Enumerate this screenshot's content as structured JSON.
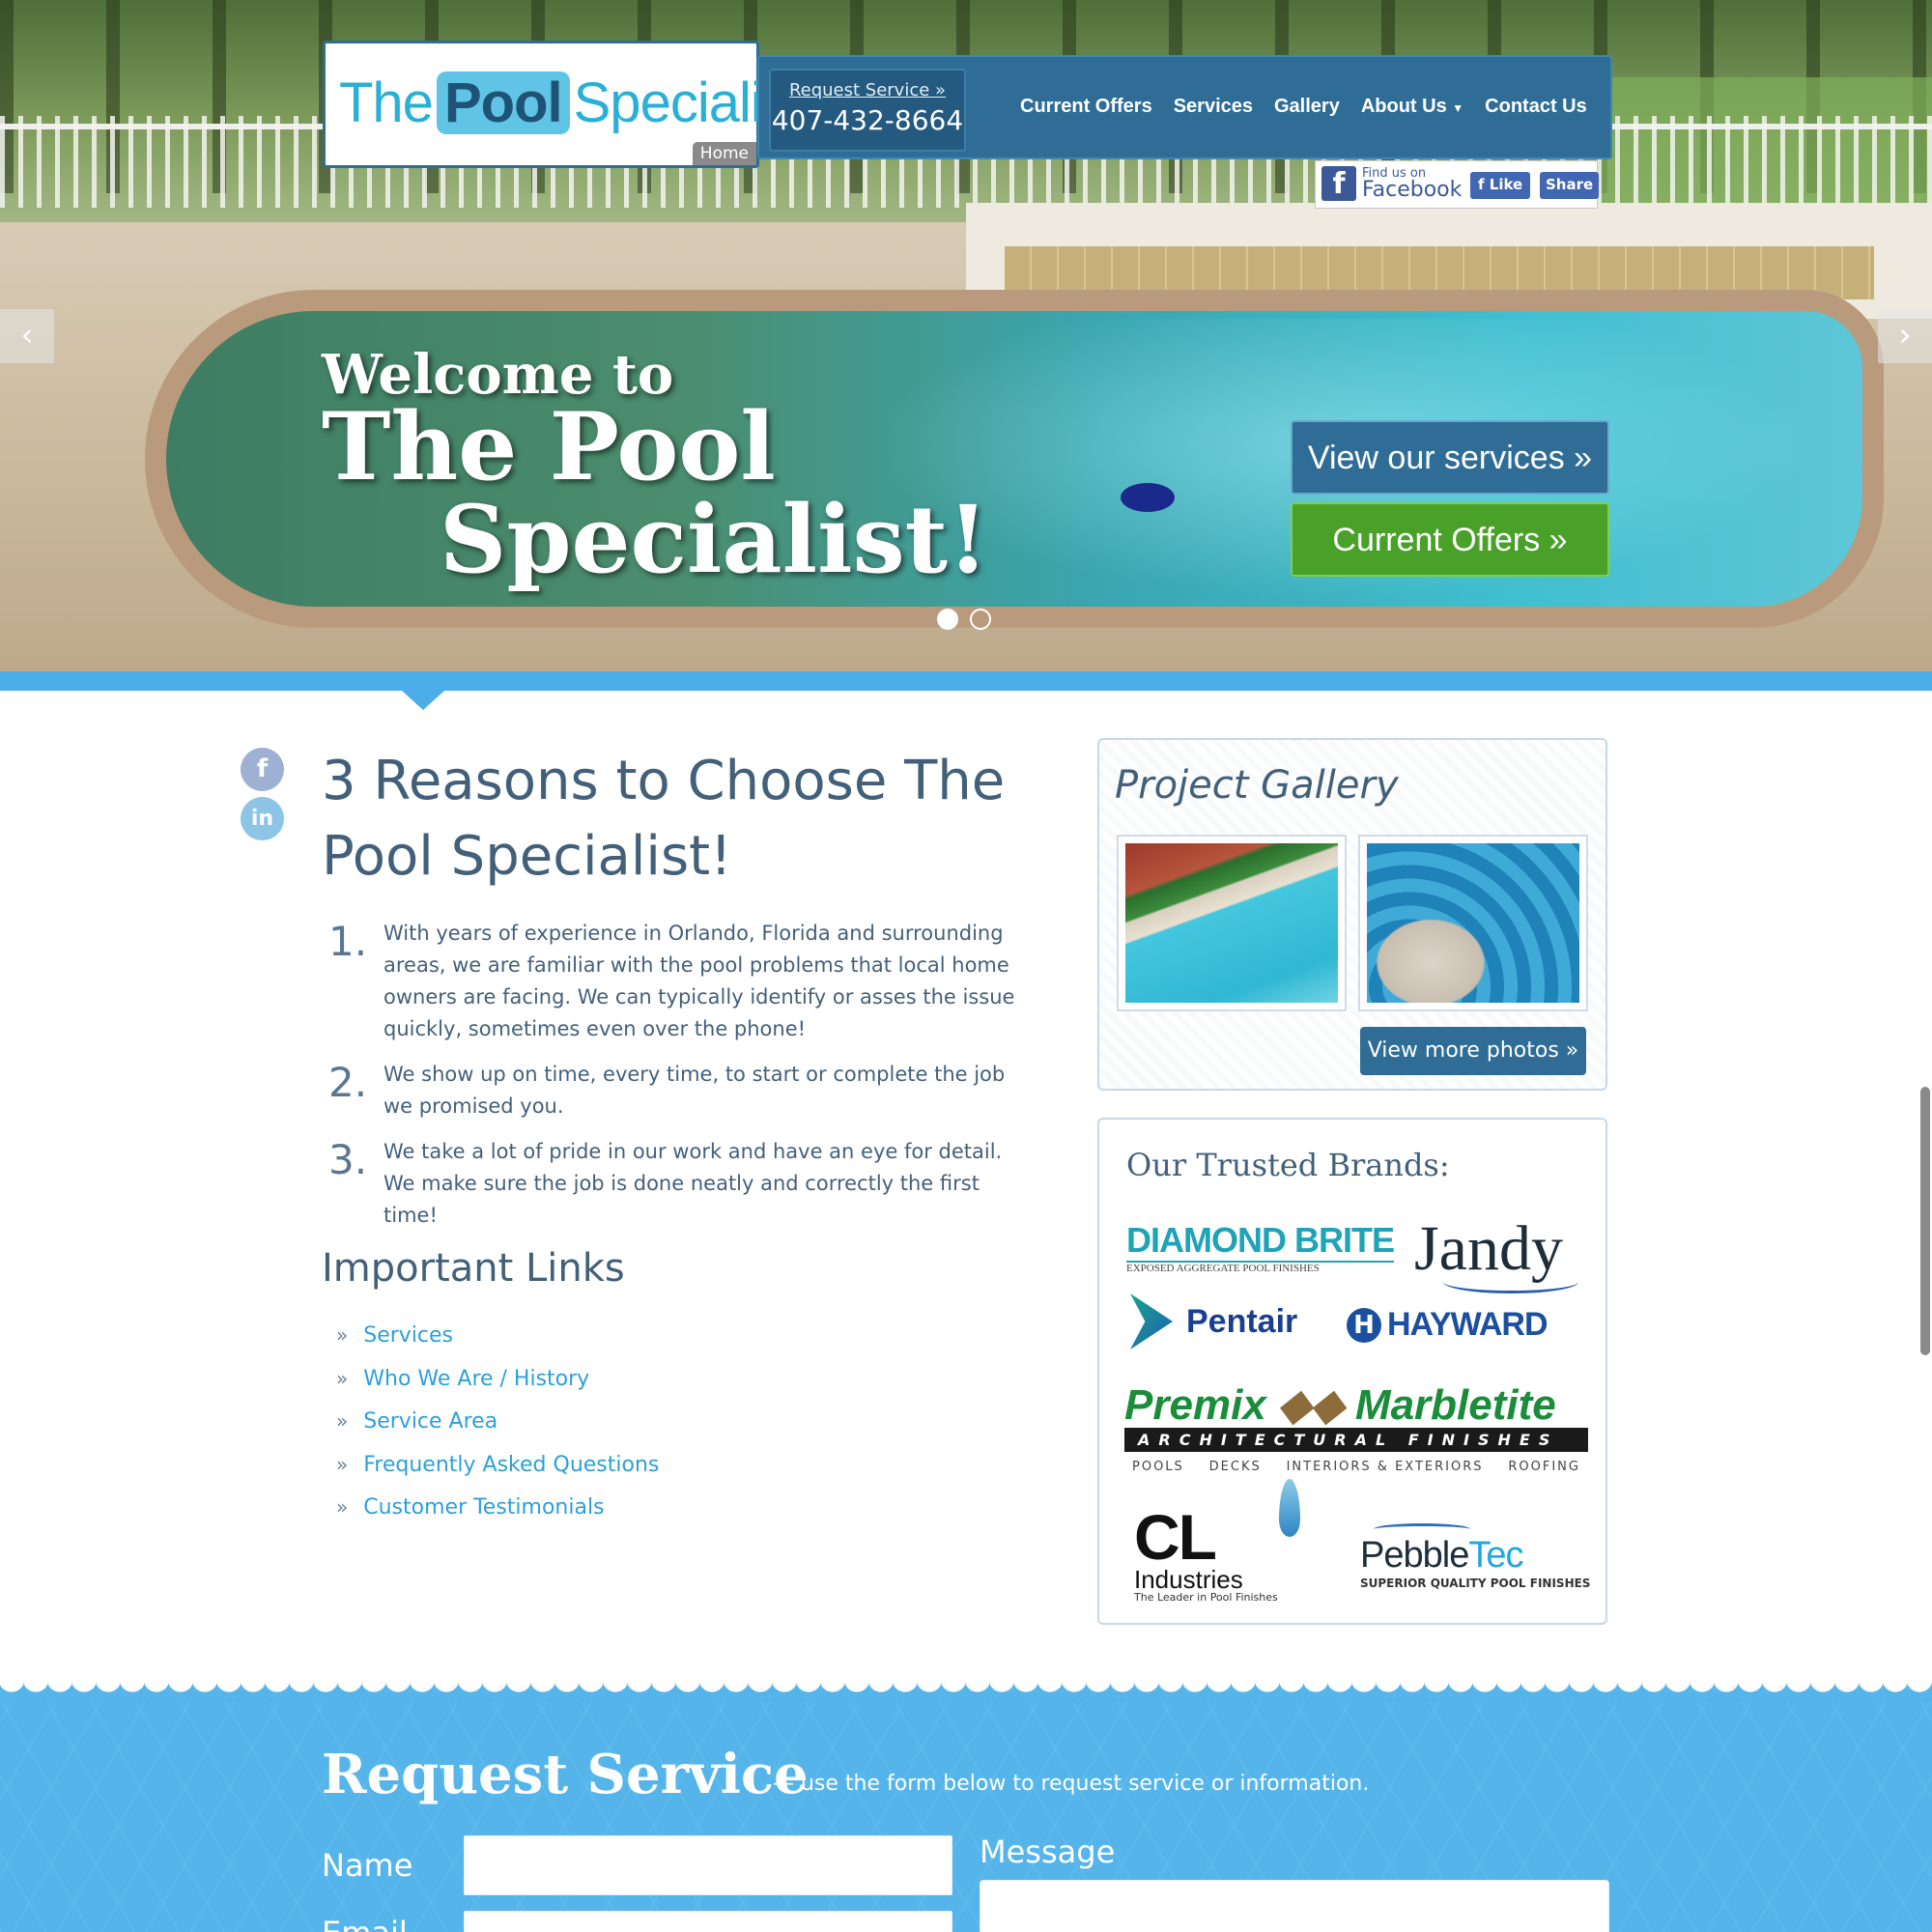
{
  "header": {
    "logo": {
      "part1": "The",
      "part2": "Pool",
      "part3": "Specialist",
      "home_tag": "Home"
    },
    "request": {
      "label": "Request Service »",
      "phone": "407-432-8664"
    },
    "nav": [
      {
        "label": "Current Offers"
      },
      {
        "label": "Services"
      },
      {
        "label": "Gallery"
      },
      {
        "label": "About Us"
      },
      {
        "label": "Contact Us"
      }
    ],
    "facebook": {
      "find_small": "Find us on",
      "find_big": "Facebook",
      "like": "Like",
      "share": "Share"
    }
  },
  "hero": {
    "welcome_line1": "Welcome to",
    "welcome_line2": "The Pool",
    "welcome_line3": "Specialist!",
    "cta_services": "View our services »",
    "cta_offers": "Current Offers »",
    "prev_arrow": "‹",
    "next_arrow": "›",
    "slides": 2,
    "active_slide": 1
  },
  "social": {
    "facebook": "f",
    "linkedin": "in"
  },
  "reasons": {
    "title": "3 Reasons to Choose The Pool Specialist!",
    "items": [
      {
        "num": "1.",
        "text": "With years of experience in Orlando, Florida and surrounding areas, we are familiar with the pool problems that local home owners are facing. We can typically identify or asses the issue quickly, sometimes even over the phone!"
      },
      {
        "num": "2.",
        "text": "We show up on time, every time, to start or complete the job we promised you."
      },
      {
        "num": "3.",
        "text": "We take a lot of pride in our work and have an eye for detail. We make sure the job is done neatly and correctly the first time!"
      }
    ]
  },
  "important_links": {
    "title": "Important Links",
    "bullet": "»",
    "items": [
      {
        "label": "Services"
      },
      {
        "label": "Who We Are / History"
      },
      {
        "label": "Service Area"
      },
      {
        "label": "Frequently Asked Questions"
      },
      {
        "label": "Customer Testimonials"
      }
    ]
  },
  "gallery": {
    "title": "Project Gallery",
    "button": "View more photos »"
  },
  "brands": {
    "title": "Our Trusted Brands:",
    "diamond_brite": {
      "name": "DIAMOND BRITE",
      "tagline": "EXPOSED AGGREGATE POOL FINISHES"
    },
    "jandy": {
      "name": "Jandy"
    },
    "pentair": {
      "name": "Pentair"
    },
    "hayward": {
      "mark": "H",
      "name": "HAYWARD"
    },
    "premix": {
      "name1": "Premix",
      "name2": "Marbletite",
      "band": "ARCHITECTURAL FINISHES",
      "sub": [
        "POOLS",
        "DECKS",
        "INTERIORS & EXTERIORS",
        "ROOFING"
      ]
    },
    "cl": {
      "name": "CL",
      "name2": "Industries",
      "tagline": "The Leader in Pool Finishes"
    },
    "pebbletec": {
      "name1": "Pebble",
      "name2": "Tec",
      "tagline": "SUPERIOR QUALITY POOL FINISHES"
    }
  },
  "request_service": {
    "title": "Request Service",
    "subtitle": "— use the form below to request service or information.",
    "name_label": "Name",
    "email_label": "Email",
    "message_label": "Message",
    "name_value": "",
    "email_value": "",
    "message_value": ""
  }
}
